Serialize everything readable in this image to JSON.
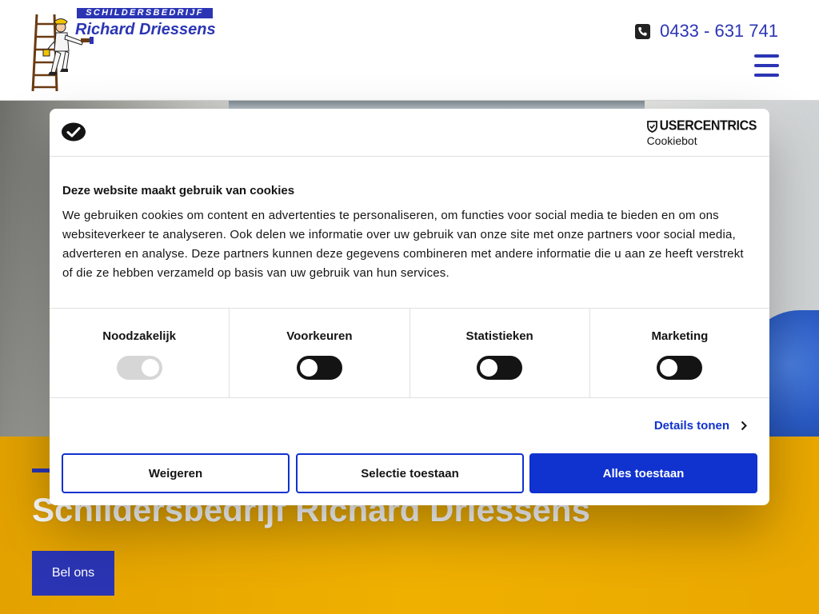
{
  "header": {
    "logo": {
      "banner": "SCHILDERSBEDRIJF",
      "name": "Richard Driessens"
    },
    "phone": {
      "icon": "phone-icon",
      "number": "0433 - 631 741"
    },
    "menu_icon": "hamburger-menu-icon"
  },
  "hero": {
    "title": "Schildersbedrijf Richard Driessens",
    "call_button": "Bel ons"
  },
  "cookie_dialog": {
    "logo_icon": "cookiebot-logo-icon",
    "brand": {
      "name": "USERCENTRICS",
      "sub": "Cookiebot"
    },
    "title": "Deze website maakt gebruik van cookies",
    "text": "We gebruiken cookies om content en advertenties te personaliseren, om functies voor social media te bieden en om ons websiteverkeer te analyseren. Ook delen we informatie over uw gebruik van onze site met onze partners voor social media, adverteren en analyse. Deze partners kunnen deze gegevens combineren met andere informatie die u aan ze heeft verstrekt of die ze hebben verzameld op basis van uw gebruik van hun services.",
    "categories": [
      {
        "label": "Noodzakelijk",
        "enabled": true,
        "locked": true
      },
      {
        "label": "Voorkeuren",
        "enabled": false,
        "locked": false
      },
      {
        "label": "Statistieken",
        "enabled": false,
        "locked": false
      },
      {
        "label": "Marketing",
        "enabled": false,
        "locked": false
      }
    ],
    "details_link": "Details tonen",
    "buttons": {
      "reject": "Weigeren",
      "selection": "Selectie toestaan",
      "accept": "Alles toestaan"
    }
  },
  "colors": {
    "brand_blue": "#2b35b4",
    "cookie_blue": "#1032cf",
    "band_yellow": "#f0b000"
  }
}
